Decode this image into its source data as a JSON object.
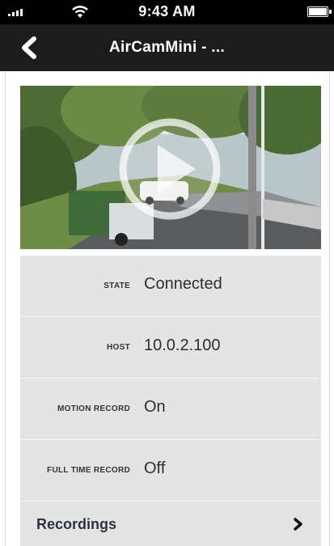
{
  "status_bar": {
    "time": "9:43 AM",
    "icons": [
      "signal-icon",
      "wifi-icon",
      "battery-icon"
    ]
  },
  "nav": {
    "title": "AirCamMini - ...",
    "back_icon": "chevron-left-icon"
  },
  "video": {
    "play_icon": "play-icon"
  },
  "info": {
    "state": {
      "label": "STATE",
      "value": "Connected"
    },
    "host": {
      "label": "HOST",
      "value": "10.0.2.100"
    },
    "motion_record": {
      "label": "MOTION RECORD",
      "value": "On"
    },
    "full_time_record": {
      "label": "FULL TIME RECORD",
      "value": "Off"
    }
  },
  "recordings": {
    "label": "Recordings",
    "chevron_icon": "chevron-right-icon"
  },
  "colors": {
    "nav_background": "#1c1c1c",
    "row_background": "#e4e4e4"
  }
}
